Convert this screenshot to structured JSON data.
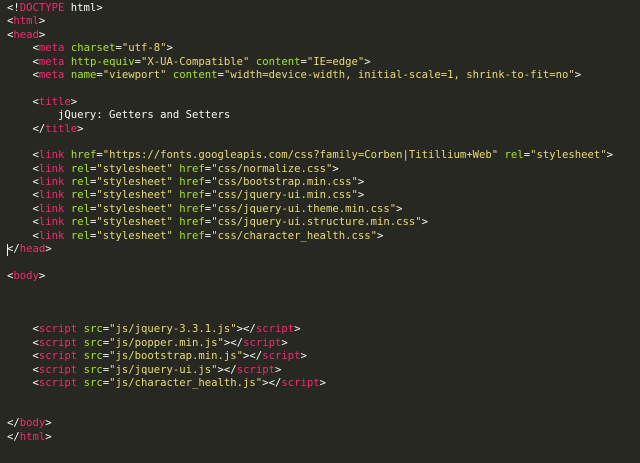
{
  "editor": {
    "theme": "Monokai",
    "colors": {
      "background": "#272822",
      "tag": "#f92672",
      "attribute": "#a6e22e",
      "string": "#e6db74",
      "text": "#f8f8f2"
    },
    "cursor_line": 18,
    "lines": [
      [
        [
          "p",
          "<!"
        ],
        [
          "tag",
          "DOCTYPE"
        ],
        [
          "text",
          " html"
        ],
        [
          "p",
          ">"
        ]
      ],
      [
        [
          "p",
          "<"
        ],
        [
          "tag",
          "html"
        ],
        [
          "p",
          ">"
        ]
      ],
      [
        [
          "p",
          "<"
        ],
        [
          "tag",
          "head"
        ],
        [
          "p",
          ">"
        ]
      ],
      [
        [
          "text",
          "    "
        ],
        [
          "p",
          "<"
        ],
        [
          "tag",
          "meta"
        ],
        [
          "text",
          " "
        ],
        [
          "attr",
          "charset"
        ],
        [
          "p",
          "="
        ],
        [
          "str",
          "\"utf-8\""
        ],
        [
          "p",
          ">"
        ]
      ],
      [
        [
          "text",
          "    "
        ],
        [
          "p",
          "<"
        ],
        [
          "tag",
          "meta"
        ],
        [
          "text",
          " "
        ],
        [
          "attr",
          "http-equiv"
        ],
        [
          "p",
          "="
        ],
        [
          "str",
          "\"X-UA-Compatible\""
        ],
        [
          "text",
          " "
        ],
        [
          "attr",
          "content"
        ],
        [
          "p",
          "="
        ],
        [
          "str",
          "\"IE=edge\""
        ],
        [
          "p",
          ">"
        ]
      ],
      [
        [
          "text",
          "    "
        ],
        [
          "p",
          "<"
        ],
        [
          "tag",
          "meta"
        ],
        [
          "text",
          " "
        ],
        [
          "attr",
          "name"
        ],
        [
          "p",
          "="
        ],
        [
          "str",
          "\"viewport\""
        ],
        [
          "text",
          " "
        ],
        [
          "attr",
          "content"
        ],
        [
          "p",
          "="
        ],
        [
          "str",
          "\"width=device-width, initial-scale=1, shrink-to-fit=no\""
        ],
        [
          "p",
          ">"
        ]
      ],
      [],
      [
        [
          "text",
          "    "
        ],
        [
          "p",
          "<"
        ],
        [
          "tag",
          "title"
        ],
        [
          "p",
          ">"
        ]
      ],
      [
        [
          "text",
          "        jQuery: Getters and Setters"
        ]
      ],
      [
        [
          "text",
          "    "
        ],
        [
          "p",
          "</"
        ],
        [
          "tag",
          "title"
        ],
        [
          "p",
          ">"
        ]
      ],
      [],
      [
        [
          "text",
          "    "
        ],
        [
          "p",
          "<"
        ],
        [
          "tag",
          "link"
        ],
        [
          "text",
          " "
        ],
        [
          "attr",
          "href"
        ],
        [
          "p",
          "="
        ],
        [
          "str",
          "\"https://fonts.googleapis.com/css?family=Corben|Titillium+Web\""
        ],
        [
          "text",
          " "
        ],
        [
          "attr",
          "rel"
        ],
        [
          "p",
          "="
        ],
        [
          "str",
          "\"stylesheet\""
        ],
        [
          "p",
          ">"
        ]
      ],
      [
        [
          "text",
          "    "
        ],
        [
          "p",
          "<"
        ],
        [
          "tag",
          "link"
        ],
        [
          "text",
          " "
        ],
        [
          "attr",
          "rel"
        ],
        [
          "p",
          "="
        ],
        [
          "str",
          "\"stylesheet\""
        ],
        [
          "text",
          " "
        ],
        [
          "attr",
          "href"
        ],
        [
          "p",
          "="
        ],
        [
          "str",
          "\"css/normalize.css\""
        ],
        [
          "p",
          ">"
        ]
      ],
      [
        [
          "text",
          "    "
        ],
        [
          "p",
          "<"
        ],
        [
          "tag",
          "link"
        ],
        [
          "text",
          " "
        ],
        [
          "attr",
          "rel"
        ],
        [
          "p",
          "="
        ],
        [
          "str",
          "\"stylesheet\""
        ],
        [
          "text",
          " "
        ],
        [
          "attr",
          "href"
        ],
        [
          "p",
          "="
        ],
        [
          "str",
          "\"css/bootstrap.min.css\""
        ],
        [
          "p",
          ">"
        ]
      ],
      [
        [
          "text",
          "    "
        ],
        [
          "p",
          "<"
        ],
        [
          "tag",
          "link"
        ],
        [
          "text",
          " "
        ],
        [
          "attr",
          "rel"
        ],
        [
          "p",
          "="
        ],
        [
          "str",
          "\"stylesheet\""
        ],
        [
          "text",
          " "
        ],
        [
          "attr",
          "href"
        ],
        [
          "p",
          "="
        ],
        [
          "str",
          "\"css/jquery-ui.min.css\""
        ],
        [
          "p",
          ">"
        ]
      ],
      [
        [
          "text",
          "    "
        ],
        [
          "p",
          "<"
        ],
        [
          "tag",
          "link"
        ],
        [
          "text",
          " "
        ],
        [
          "attr",
          "rel"
        ],
        [
          "p",
          "="
        ],
        [
          "str",
          "\"stylesheet\""
        ],
        [
          "text",
          " "
        ],
        [
          "attr",
          "href"
        ],
        [
          "p",
          "="
        ],
        [
          "str",
          "\"css/jquery-ui.theme.min.css\""
        ],
        [
          "p",
          ">"
        ]
      ],
      [
        [
          "text",
          "    "
        ],
        [
          "p",
          "<"
        ],
        [
          "tag",
          "link"
        ],
        [
          "text",
          " "
        ],
        [
          "attr",
          "rel"
        ],
        [
          "p",
          "="
        ],
        [
          "str",
          "\"stylesheet\""
        ],
        [
          "text",
          " "
        ],
        [
          "attr",
          "href"
        ],
        [
          "p",
          "="
        ],
        [
          "str",
          "\"css/jquery-ui.structure.min.css\""
        ],
        [
          "p",
          ">"
        ]
      ],
      [
        [
          "text",
          "    "
        ],
        [
          "p",
          "<"
        ],
        [
          "tag",
          "link"
        ],
        [
          "text",
          " "
        ],
        [
          "attr",
          "rel"
        ],
        [
          "p",
          "="
        ],
        [
          "str",
          "\"stylesheet\""
        ],
        [
          "text",
          " "
        ],
        [
          "attr",
          "href"
        ],
        [
          "p",
          "="
        ],
        [
          "str",
          "\"css/character_health.css\""
        ],
        [
          "p",
          ">"
        ]
      ],
      [
        [
          "p",
          "</"
        ],
        [
          "tag",
          "head"
        ],
        [
          "p",
          ">"
        ]
      ],
      [],
      [
        [
          "p",
          "<"
        ],
        [
          "tag",
          "body"
        ],
        [
          "p",
          ">"
        ]
      ],
      [],
      [],
      [],
      [
        [
          "text",
          "    "
        ],
        [
          "p",
          "<"
        ],
        [
          "tag",
          "script"
        ],
        [
          "text",
          " "
        ],
        [
          "attr",
          "src"
        ],
        [
          "p",
          "="
        ],
        [
          "str",
          "\"js/jquery-3.3.1.js\""
        ],
        [
          "p",
          "></"
        ],
        [
          "tag",
          "script"
        ],
        [
          "p",
          ">"
        ]
      ],
      [
        [
          "text",
          "    "
        ],
        [
          "p",
          "<"
        ],
        [
          "tag",
          "script"
        ],
        [
          "text",
          " "
        ],
        [
          "attr",
          "src"
        ],
        [
          "p",
          "="
        ],
        [
          "str",
          "\"js/popper.min.js\""
        ],
        [
          "p",
          "></"
        ],
        [
          "tag",
          "script"
        ],
        [
          "p",
          ">"
        ]
      ],
      [
        [
          "text",
          "    "
        ],
        [
          "p",
          "<"
        ],
        [
          "tag",
          "script"
        ],
        [
          "text",
          " "
        ],
        [
          "attr",
          "src"
        ],
        [
          "p",
          "="
        ],
        [
          "str",
          "\"js/bootstrap.min.js\""
        ],
        [
          "p",
          "></"
        ],
        [
          "tag",
          "script"
        ],
        [
          "p",
          ">"
        ]
      ],
      [
        [
          "text",
          "    "
        ],
        [
          "p",
          "<"
        ],
        [
          "tag",
          "script"
        ],
        [
          "text",
          " "
        ],
        [
          "attr",
          "src"
        ],
        [
          "p",
          "="
        ],
        [
          "str",
          "\"js/jquery-ui.js\""
        ],
        [
          "p",
          "></"
        ],
        [
          "tag",
          "script"
        ],
        [
          "p",
          ">"
        ]
      ],
      [
        [
          "text",
          "    "
        ],
        [
          "p",
          "<"
        ],
        [
          "tag",
          "script"
        ],
        [
          "text",
          " "
        ],
        [
          "attr",
          "src"
        ],
        [
          "p",
          "="
        ],
        [
          "str",
          "\"js/character_health.js\""
        ],
        [
          "p",
          "></"
        ],
        [
          "tag",
          "script"
        ],
        [
          "p",
          ">"
        ]
      ],
      [],
      [],
      [
        [
          "p",
          "</"
        ],
        [
          "tag",
          "body"
        ],
        [
          "p",
          ">"
        ]
      ],
      [
        [
          "p",
          "</"
        ],
        [
          "tag",
          "html"
        ],
        [
          "p",
          ">"
        ]
      ]
    ]
  }
}
